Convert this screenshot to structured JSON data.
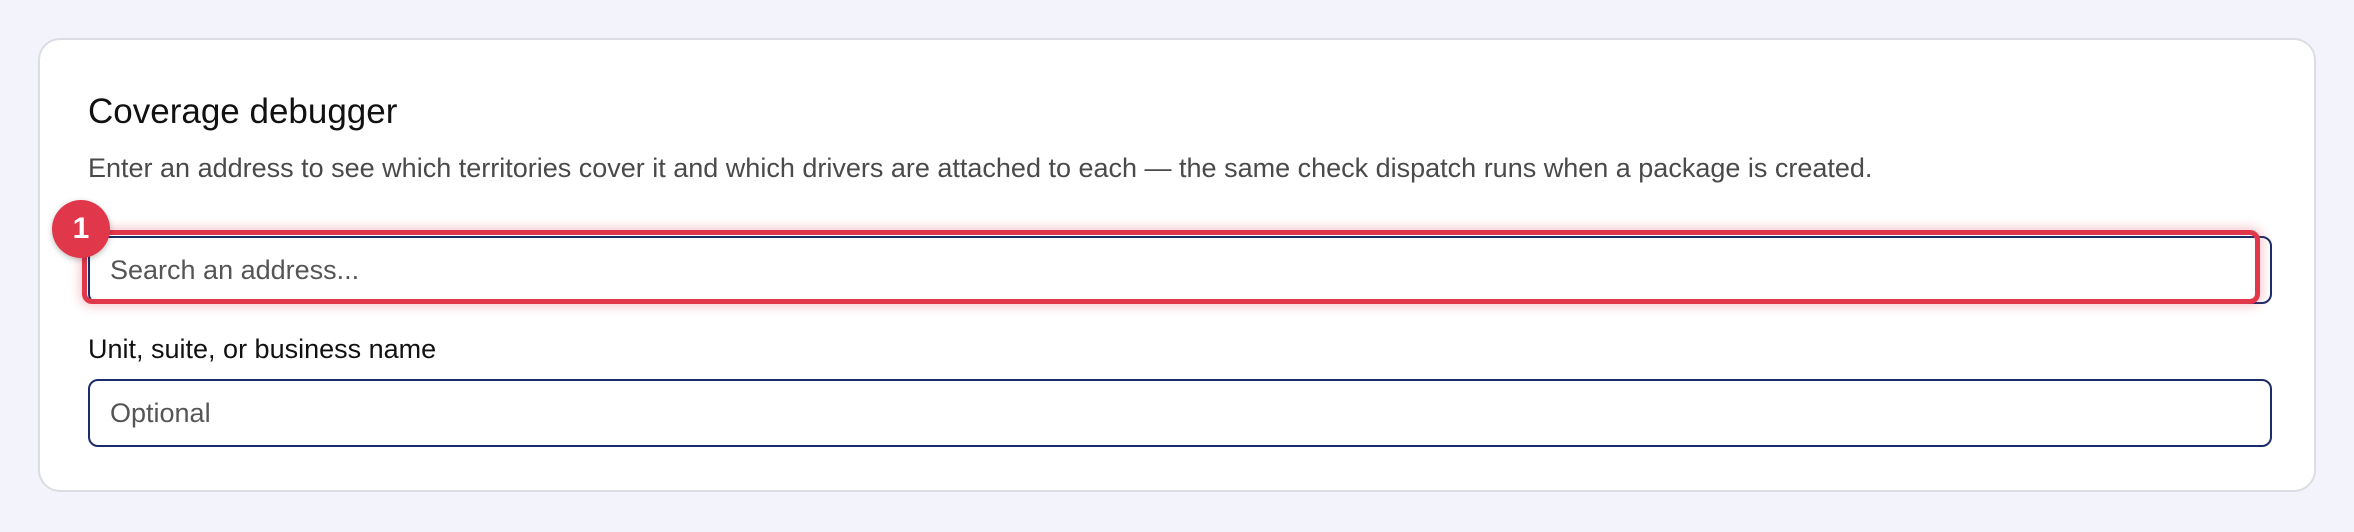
{
  "card": {
    "title": "Coverage debugger",
    "subtitle": "Enter an address to see which territories cover it and which drivers are attached to each — the same check dispatch runs when a package is created."
  },
  "address_search": {
    "placeholder": "Search an address..."
  },
  "unit_field": {
    "label": "Unit, suite, or business name",
    "placeholder": "Optional"
  },
  "annotation": {
    "marker_number": "1",
    "color": "#e0384a"
  },
  "colors": {
    "background": "#f3f4fb",
    "input_border": "#1a2d6b"
  }
}
